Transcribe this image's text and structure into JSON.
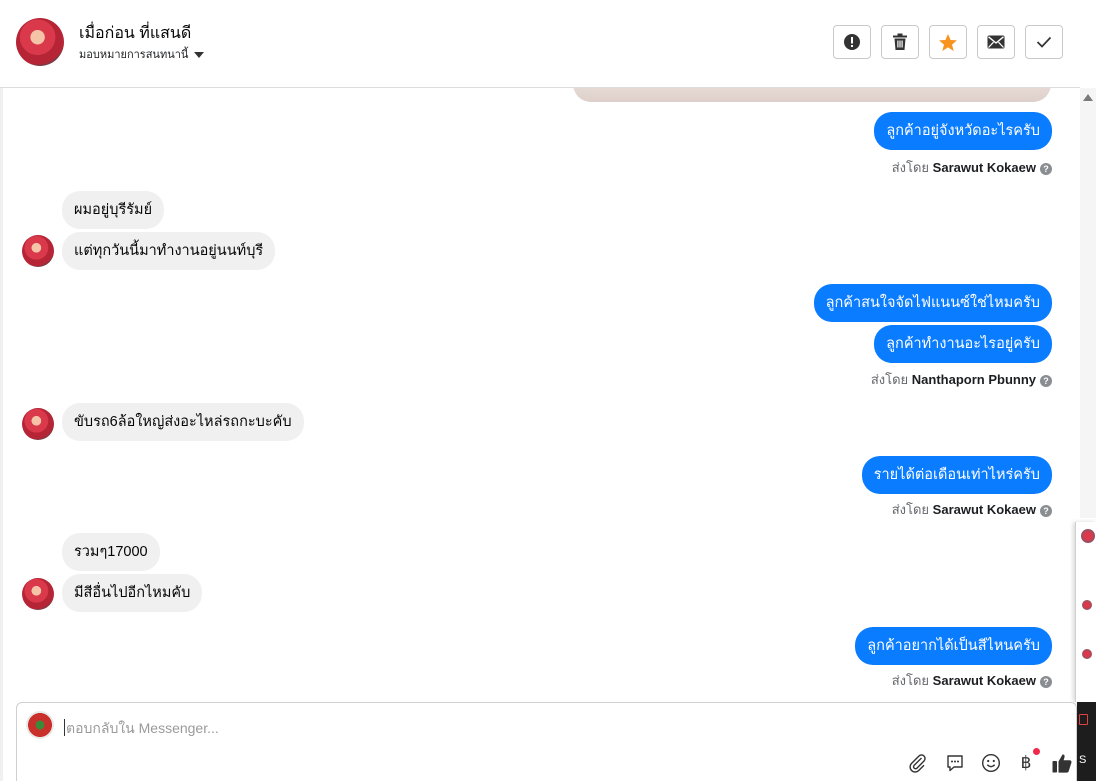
{
  "header": {
    "contact_name": "เมื่อก่อน ที่แสนดี",
    "assign_label": "มอบหมายการสนทนานี้",
    "buttons": [
      {
        "name": "report-spam-button",
        "icon": "exclamation-icon"
      },
      {
        "name": "delete-button",
        "icon": "trash-icon"
      },
      {
        "name": "star-button",
        "icon": "star-icon",
        "color": "#f7931e"
      },
      {
        "name": "mark-unread-button",
        "icon": "envelope-icon"
      },
      {
        "name": "mark-done-button",
        "icon": "check-icon"
      }
    ]
  },
  "messages": [
    {
      "dir": "out",
      "text": "ลูกค้าอยู่จังหวัดอะไรครับ"
    },
    {
      "sent_by_prefix": "ส่งโดย",
      "sent_by": "Sarawut Kokaew"
    },
    {
      "dir": "in",
      "text": "ผมอยู่บุรีรัมย์"
    },
    {
      "dir": "in",
      "text": "แต่ทุกวันนี้มาทำงานอยู่นนท์บุรี"
    },
    {
      "dir": "out",
      "text": "ลูกค้าสนใจจัดไฟแนนซ์ใช่ไหมครับ"
    },
    {
      "dir": "out",
      "text": "ลูกค้าทำงานอะไรอยู่ครับ"
    },
    {
      "sent_by_prefix": "ส่งโดย",
      "sent_by": "Nanthaporn Pbunny"
    },
    {
      "dir": "in",
      "text": "ขับรถ6ล้อใหญ่ส่งอะไหล่รถกะบะคับ"
    },
    {
      "dir": "out",
      "text": "รายได้ต่อเดือนเท่าไหร่ครับ"
    },
    {
      "sent_by_prefix": "ส่งโดย",
      "sent_by": "Sarawut Kokaew"
    },
    {
      "dir": "in",
      "text": "รวมๆ17000"
    },
    {
      "dir": "in",
      "text": "มีสีอื่นไปอีกไหมคับ"
    },
    {
      "dir": "out",
      "text": "ลูกค้าอยากได้เป็นสีไหนครับ"
    },
    {
      "sent_by_prefix": "ส่งโดย",
      "sent_by": "Sarawut Kokaew"
    }
  ],
  "composer": {
    "placeholder": "ตอบกลับใน Messenger...",
    "tools": [
      "paperclip-icon",
      "comment-icon",
      "smiley-icon",
      "baht-icon",
      "thumbs-up-icon"
    ]
  },
  "sidepanel": {
    "partial_text": "S"
  },
  "colors": {
    "outgoing_bubble": "#0a7cff",
    "incoming_bubble": "#f0f0f0",
    "star": "#f7931e"
  }
}
